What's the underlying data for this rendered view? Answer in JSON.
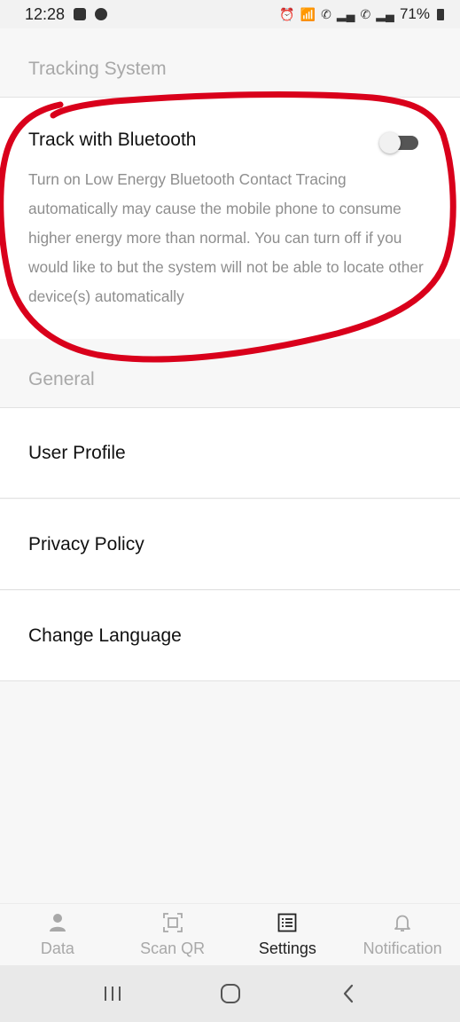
{
  "status_bar": {
    "time": "12:28",
    "battery": "71%"
  },
  "sections": {
    "tracking_header": "Tracking System",
    "general_header": "General"
  },
  "bluetooth": {
    "title": "Track with Bluetooth",
    "description": "Turn on Low Energy Bluetooth Contact Tracing automatically may cause the mobile phone to consume higher energy more than normal. You can turn off if you would like to but the system will not be able to locate other device(s) automatically",
    "toggle_on": false
  },
  "general_items": [
    {
      "label": "User Profile"
    },
    {
      "label": "Privacy Policy"
    },
    {
      "label": "Change Language"
    }
  ],
  "tabs": [
    {
      "label": "Data",
      "icon": "person-icon",
      "active": false
    },
    {
      "label": "Scan QR",
      "icon": "scan-qr-icon",
      "active": false
    },
    {
      "label": "Settings",
      "icon": "list-icon",
      "active": true
    },
    {
      "label": "Notification",
      "icon": "bell-icon",
      "active": false
    }
  ],
  "colors": {
    "annotation_red": "#d9001b",
    "muted_text": "#a8a8a8",
    "description_text": "#8e8e8e"
  }
}
